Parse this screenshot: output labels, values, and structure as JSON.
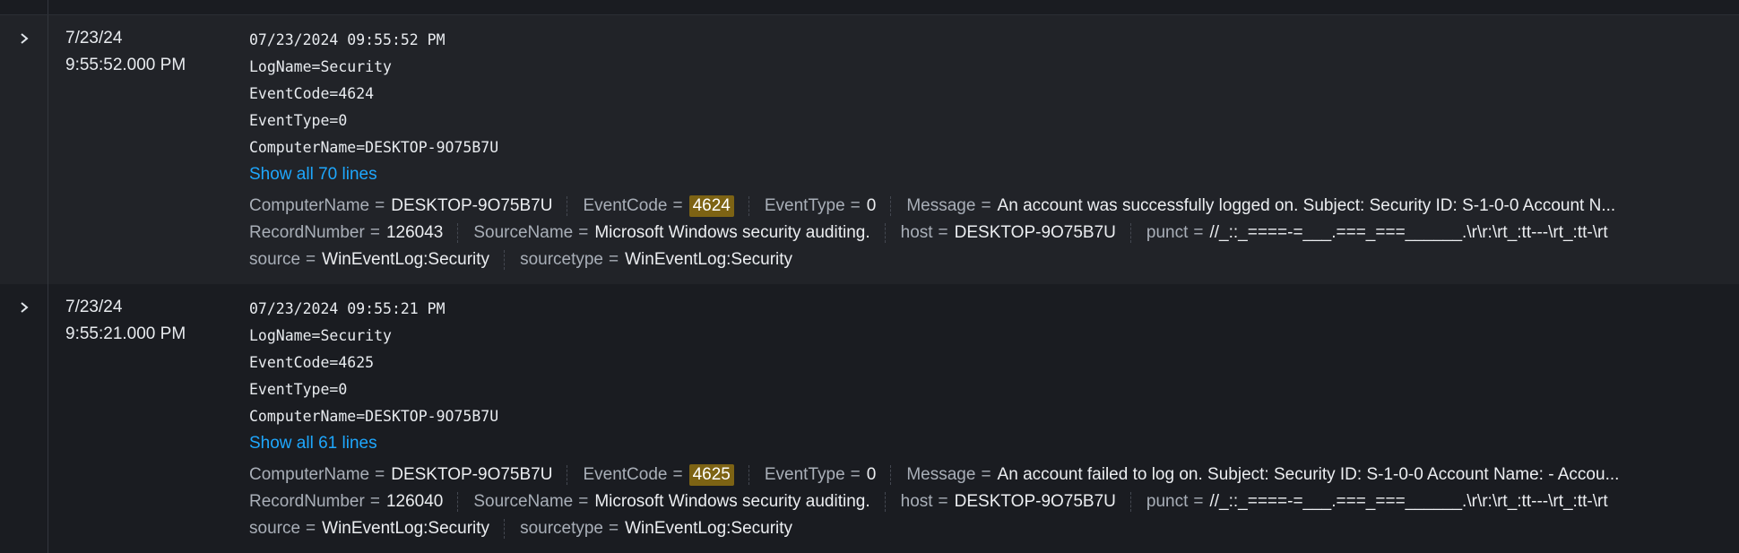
{
  "events": [
    {
      "date": "7/23/24",
      "time": "9:55:52.000 PM",
      "raw": [
        "07/23/2024 09:55:52 PM",
        "LogName=Security",
        "EventCode=4624",
        "EventType=0",
        "ComputerName=DESKTOP-9O75B7U"
      ],
      "show_all": "Show all 70 lines",
      "fields": [
        {
          "key": "ComputerName",
          "value": "DESKTOP-9O75B7U"
        },
        {
          "key": "EventCode",
          "value": "4624"
        },
        {
          "key": "EventType",
          "value": "0"
        },
        {
          "key": "Message",
          "value": "An account was successfully logged on. Subject: Security ID: S-1-0-0 Account N..."
        },
        {
          "key": "RecordNumber",
          "value": "126043"
        },
        {
          "key": "SourceName",
          "value": "Microsoft Windows security auditing."
        },
        {
          "key": "host",
          "value": "DESKTOP-9O75B7U"
        },
        {
          "key": "punct",
          "value": "//_::_====-=___.===_===______.\\r\\r:\\rt_:tt---\\rt_:tt-\\rt"
        },
        {
          "key": "source",
          "value": "WinEventLog:Security"
        },
        {
          "key": "sourcetype",
          "value": "WinEventLog:Security"
        }
      ]
    },
    {
      "date": "7/23/24",
      "time": "9:55:21.000 PM",
      "raw": [
        "07/23/2024 09:55:21 PM",
        "LogName=Security",
        "EventCode=4625",
        "EventType=0",
        "ComputerName=DESKTOP-9O75B7U"
      ],
      "show_all": "Show all 61 lines",
      "fields": [
        {
          "key": "ComputerName",
          "value": "DESKTOP-9O75B7U"
        },
        {
          "key": "EventCode",
          "value": "4625"
        },
        {
          "key": "EventType",
          "value": "0"
        },
        {
          "key": "Message",
          "value": "An account failed to log on. Subject: Security ID: S-1-0-0 Account Name: - Accou..."
        },
        {
          "key": "RecordNumber",
          "value": "126040"
        },
        {
          "key": "SourceName",
          "value": "Microsoft Windows security auditing."
        },
        {
          "key": "host",
          "value": "DESKTOP-9O75B7U"
        },
        {
          "key": "punct",
          "value": "//_::_====-=___.===_===______.\\r\\r:\\rt_:tt---\\rt_:tt-\\rt"
        },
        {
          "key": "source",
          "value": "WinEventLog:Security"
        },
        {
          "key": "sourcetype",
          "value": "WinEventLog:Security"
        }
      ]
    }
  ],
  "equals_sign": "=",
  "icons": {
    "expand": "chevron-right-icon"
  },
  "colors": {
    "highlight": "#7d6314",
    "link": "#1ea7fd",
    "selected_row_bg": "#212328",
    "bg": "#1a1c21"
  }
}
